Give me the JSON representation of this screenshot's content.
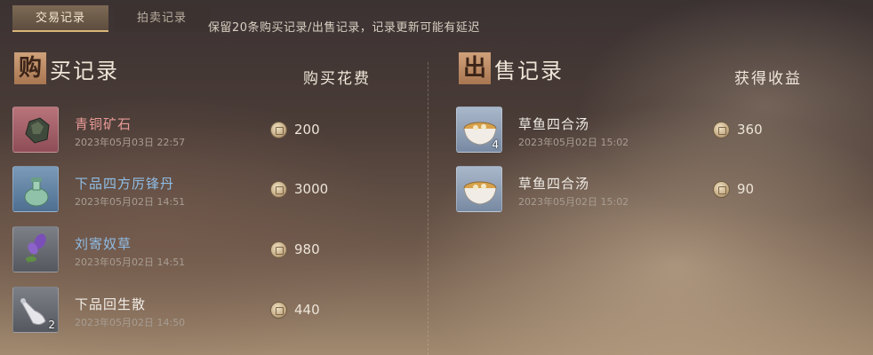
{
  "tabs": [
    {
      "label": "交易记录"
    },
    {
      "label": "拍卖记录"
    }
  ],
  "notice": "保留20条购买记录/出售记录，记录更新可能有延迟",
  "buy": {
    "title_char": "购",
    "title_rest": "买记录",
    "column_header": "购买花费",
    "items": [
      {
        "name": "青铜矿石",
        "time": "2023年05月03日 22:57",
        "price": "200",
        "quantity": "",
        "rarity_color": "#e89a96",
        "icon": "bronze-ore-icon"
      },
      {
        "name": "下品四方厉锋丹",
        "time": "2023年05月02日 14:51",
        "price": "3000",
        "quantity": "",
        "rarity_color": "#8fbde6",
        "icon": "pill-bottle-icon"
      },
      {
        "name": "刘寄奴草",
        "time": "2023年05月02日 14:51",
        "price": "980",
        "quantity": "",
        "rarity_color": "#8fbde6",
        "icon": "herb-icon"
      },
      {
        "name": "下品回生散",
        "time": "2023年05月02日 14:50",
        "price": "440",
        "quantity": "2",
        "rarity_color": "#f0ece6",
        "icon": "medicine-gourd-icon"
      }
    ]
  },
  "sell": {
    "title_char": "出",
    "title_rest": "售记录",
    "column_header": "获得收益",
    "items": [
      {
        "name": "草鱼四合汤",
        "time": "2023年05月02日 15:02",
        "price": "360",
        "quantity": "4",
        "icon": "soup-bowl-icon"
      },
      {
        "name": "草鱼四合汤",
        "time": "2023年05月02日 15:02",
        "price": "90",
        "quantity": "",
        "icon": "soup-bowl-icon"
      }
    ]
  },
  "colors": {
    "accent_gold": "#d9b679",
    "title_box": "#cfa17a",
    "rarity_red": "#e89a96",
    "rarity_blue": "#8fbde6"
  }
}
